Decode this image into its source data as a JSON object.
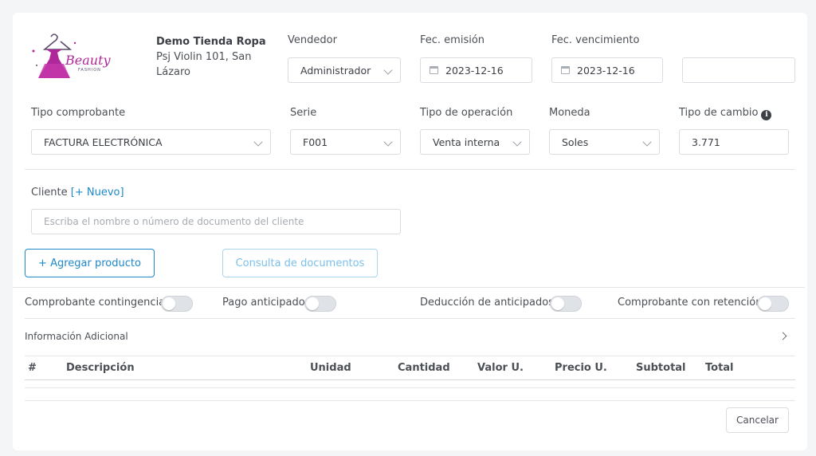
{
  "company": {
    "name": "Demo Tienda Ropa",
    "address_line1": "Psj Violin 101, San",
    "address_line2": "Lázaro",
    "logo_text": "Beauty",
    "logo_subtext": "FASHION",
    "logo_color": "#b0279a"
  },
  "header": {
    "vendedor_label": "Vendedor",
    "vendedor_value": "Administrador",
    "emision_label": "Fec. emisión",
    "emision_value": "2023-12-16",
    "vencimiento_label": "Fec. vencimiento",
    "vencimiento_value": "2023-12-16",
    "extra_value": ""
  },
  "row2": {
    "tipo_comprobante_label": "Tipo comprobante",
    "tipo_comprobante_value": "FACTURA ELECTRÓNICA",
    "serie_label": "Serie",
    "serie_value": "F001",
    "tipo_operacion_label": "Tipo de operación",
    "tipo_operacion_value": "Venta interna",
    "moneda_label": "Moneda",
    "moneda_value": "Soles",
    "tipo_cambio_label": "Tipo de cambio",
    "tipo_cambio_value": "3.771"
  },
  "cliente": {
    "label": "Cliente",
    "nuevo_link": "[+ Nuevo]",
    "placeholder": "Escriba el nombre o número de documento del cliente"
  },
  "actions": {
    "agregar_producto": "+ Agregar producto",
    "consulta_documentos": "Consulta de documentos",
    "cancelar": "Cancelar"
  },
  "toggles": [
    {
      "label": "Comprobante contingencia",
      "on": false
    },
    {
      "label": "Pago anticipado",
      "on": false
    },
    {
      "label": "Deducción de anticipados",
      "on": false
    },
    {
      "label": "Comprobante con retención",
      "on": false
    }
  ],
  "info_adicional": "Información Adicional",
  "table": {
    "columns": [
      "#",
      "Descripción",
      "Unidad",
      "Cantidad",
      "Valor U.",
      "Precio U.",
      "Subtotal",
      "Total"
    ],
    "rows": []
  },
  "colors": {
    "accent": "#1e88c9",
    "accent_light": "#7cc0e8",
    "border": "#d9dce1"
  }
}
